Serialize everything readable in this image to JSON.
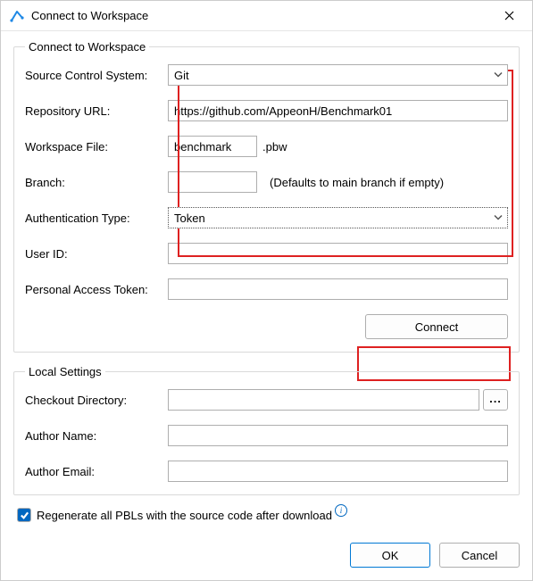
{
  "dialog": {
    "title": "Connect to Workspace"
  },
  "connectGroup": {
    "legend": "Connect to Workspace",
    "sourceControlLabel": "Source Control System:",
    "sourceControlValue": "Git",
    "repoUrlLabel": "Repository URL:",
    "repoUrlValue": "https://github.com/AppeonH/Benchmark01",
    "workspaceFileLabel": "Workspace File:",
    "workspaceFileValue": "benchmark",
    "workspaceFileExt": ".pbw",
    "branchLabel": "Branch:",
    "branchValue": "",
    "branchHint": "(Defaults to main branch if empty)",
    "authTypeLabel": "Authentication Type:",
    "authTypeValue": "Token",
    "userIdLabel": "User ID:",
    "userIdValue": "",
    "patLabel": "Personal Access Token:",
    "patValue": "",
    "connectButton": "Connect"
  },
  "localGroup": {
    "legend": "Local Settings",
    "checkoutDirLabel": "Checkout Directory:",
    "checkoutDirValue": "",
    "browseLabel": "...",
    "authorNameLabel": "Author Name:",
    "authorNameValue": "",
    "authorEmailLabel": "Author Email:",
    "authorEmailValue": ""
  },
  "regenerate": {
    "label": "Regenerate all PBLs with the source code after download",
    "checked": true
  },
  "buttons": {
    "ok": "OK",
    "cancel": "Cancel"
  }
}
